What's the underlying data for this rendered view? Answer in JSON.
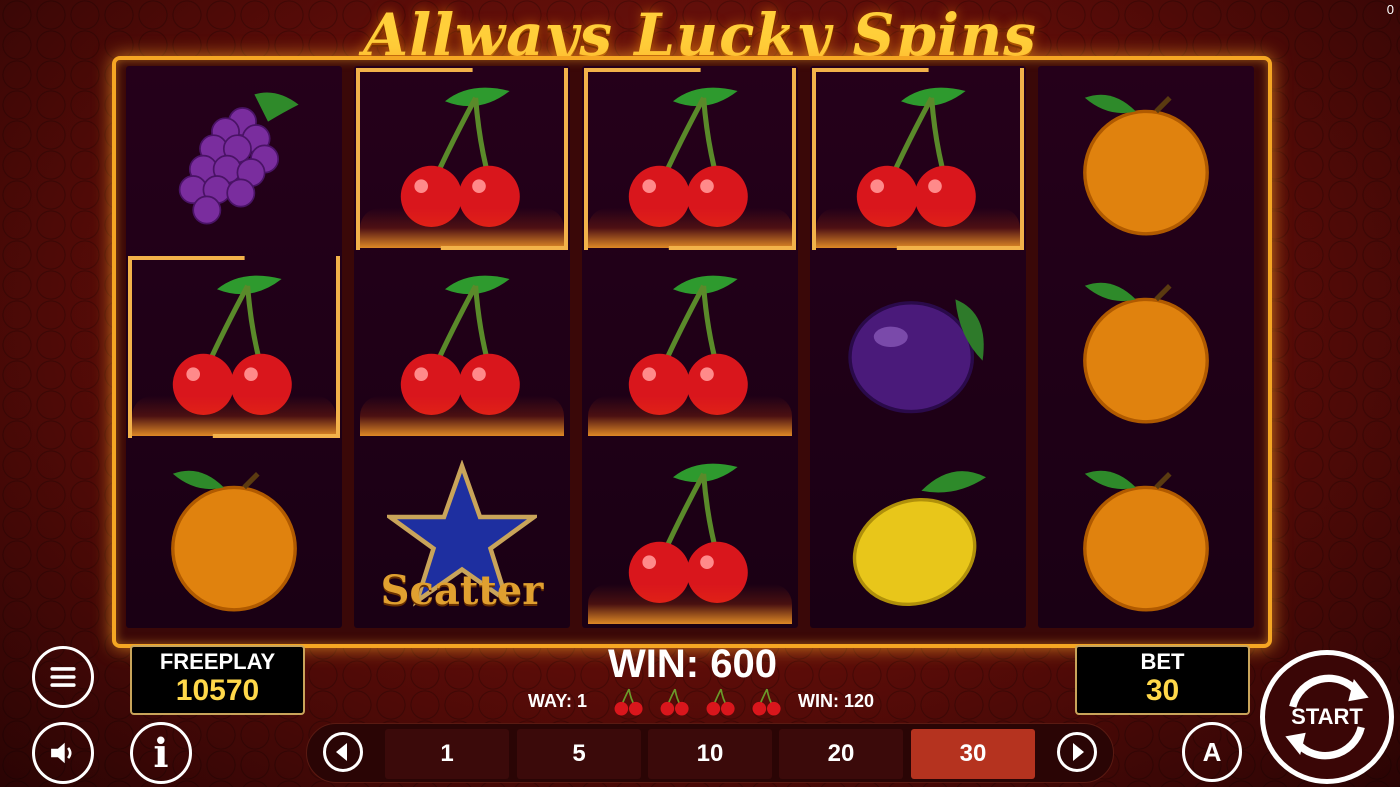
{
  "corner_indicator": "0",
  "game_title": "Allways Lucky Spins",
  "reels": [
    [
      "grapes",
      "cherries",
      "orange"
    ],
    [
      "cherries",
      "cherries",
      "scatter"
    ],
    [
      "cherries",
      "cherries",
      "cherries"
    ],
    [
      "cherries",
      "plum",
      "lemon"
    ],
    [
      "orange",
      "orange",
      "orange"
    ]
  ],
  "scatter_label": "Scatter",
  "freeplay": {
    "label": "FREEPLAY",
    "value": "10570"
  },
  "bet": {
    "label": "BET",
    "value": "30"
  },
  "win": {
    "main": "WIN: 600",
    "way_label": "WAY: 1",
    "line_win": "WIN: 120",
    "symbols_icon": "cherries-icon"
  },
  "bet_options": [
    "1",
    "5",
    "10",
    "20",
    "30"
  ],
  "selected_bet": "30",
  "buttons": {
    "start_label": "START",
    "info_label": "i",
    "auto_label": "A"
  },
  "colors": {
    "accent": "#f5a623",
    "value": "#ffd84a",
    "selected_bet": "#b5331f"
  }
}
